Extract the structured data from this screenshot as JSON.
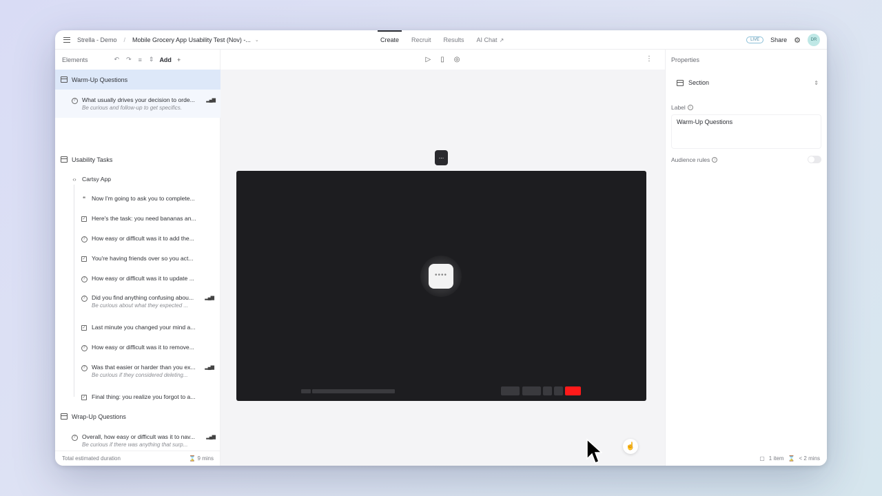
{
  "topbar": {
    "workspace": "Strella - Demo",
    "study_title": "Mobile Grocery App Usability Test (Nov) -...",
    "tabs": [
      {
        "label": "Create",
        "active": true
      },
      {
        "label": "Recruit",
        "active": false
      },
      {
        "label": "Results",
        "active": false
      },
      {
        "label": "AI Chat",
        "active": false
      }
    ],
    "live_badge": "LIVE",
    "share_label": "Share",
    "avatar_initials": "DR"
  },
  "elements_panel": {
    "title": "Elements",
    "add_label": "Add",
    "sections": [
      {
        "label": "Warm-Up Questions"
      },
      {
        "label": "Usability Tasks"
      },
      {
        "label": "Wrap-Up Questions"
      }
    ],
    "warmup_item": {
      "text": "What usually drives your decision to orde...",
      "sub": "Be curious and follow-up to get specifics."
    },
    "group_label": "Cartsy App",
    "task_items": [
      {
        "icon": "quote-icon",
        "text": "Now I'm going to ask you to complete...",
        "sub": ""
      },
      {
        "icon": "task-icon",
        "text": "Here's the task: you need bananas an...",
        "sub": ""
      },
      {
        "icon": "question-icon",
        "text": "How easy or difficult was it to add the...",
        "sub": ""
      },
      {
        "icon": "task-icon",
        "text": "You're having friends over so you act...",
        "sub": ""
      },
      {
        "icon": "question-icon",
        "text": "How easy or difficult was it to update ...",
        "sub": ""
      },
      {
        "icon": "question-icon",
        "text": "Did you find anything confusing abou...",
        "sub": "Be curious about what they expected ..."
      },
      {
        "icon": "task-icon",
        "text": "Last minute you changed your mind a...",
        "sub": ""
      },
      {
        "icon": "question-icon",
        "text": "How easy or difficult was it to remove...",
        "sub": ""
      },
      {
        "icon": "question-icon",
        "text": "Was that easier or harder than you ex...",
        "sub": "Be curious if they considered deleting..."
      },
      {
        "icon": "task-icon",
        "text": "Final thing: you realize you forgot to a...",
        "sub": ""
      }
    ],
    "wrapup_item": {
      "text": "Overall, how easy or difficult was it to nav...",
      "sub": "Be curious if there was anything that surp..."
    },
    "footer_label": "Total estimated duration",
    "footer_duration": "9 mins"
  },
  "canvas": {
    "dots_label": "...",
    "spinner_label": "••••"
  },
  "properties_panel": {
    "title": "Properties",
    "type_value": "Section",
    "label_caption": "Label",
    "label_value": "Warm-Up Questions",
    "audience_caption": "Audience rules",
    "footer_items": "1 item",
    "footer_time": "< 2 mins"
  },
  "colors": {
    "accent_selected": "#dde8f9",
    "video_bg": "#1d1d20",
    "record_red": "#ff1a1a"
  }
}
